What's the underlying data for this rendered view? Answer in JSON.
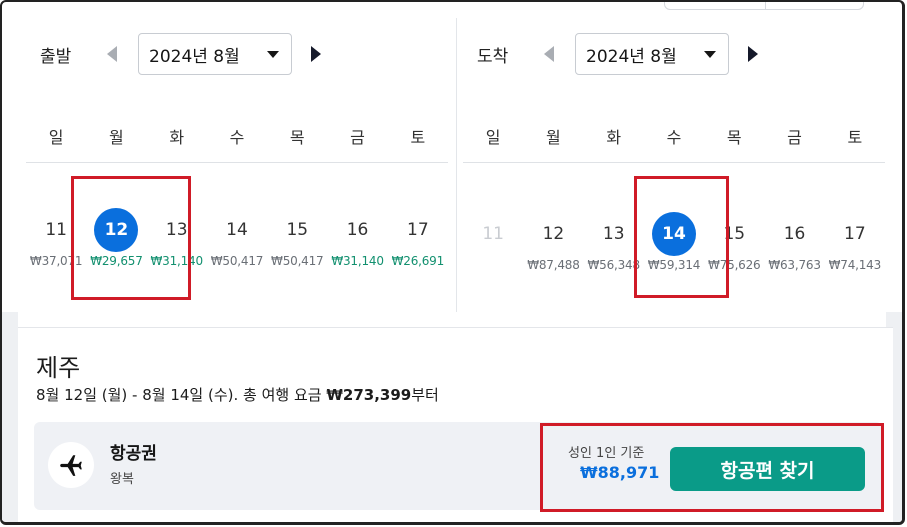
{
  "weekdays": [
    "일",
    "월",
    "화",
    "수",
    "목",
    "금",
    "토"
  ],
  "departure": {
    "title": "출발",
    "month": "2024년 8월",
    "days": [
      {
        "num": "11",
        "price": "₩37,071",
        "price_color": "gray"
      },
      {
        "num": "12",
        "price": "₩29,657",
        "price_color": "green",
        "selected": true
      },
      {
        "num": "13",
        "price": "₩31,140",
        "price_color": "green"
      },
      {
        "num": "14",
        "price": "₩50,417",
        "price_color": "gray"
      },
      {
        "num": "15",
        "price": "₩50,417",
        "price_color": "gray"
      },
      {
        "num": "16",
        "price": "₩31,140",
        "price_color": "green"
      },
      {
        "num": "17",
        "price": "₩26,691",
        "price_color": "green"
      }
    ]
  },
  "arrival": {
    "title": "도착",
    "month": "2024년 8월",
    "days": [
      {
        "num": "11",
        "price": "",
        "muted": true
      },
      {
        "num": "12",
        "price": "₩87,488",
        "price_color": "gray"
      },
      {
        "num": "13",
        "price": "₩56,348",
        "price_color": "gray"
      },
      {
        "num": "14",
        "price": "₩59,314",
        "price_color": "gray",
        "selected": true
      },
      {
        "num": "15",
        "price": "₩75,626",
        "price_color": "gray"
      },
      {
        "num": "16",
        "price": "₩63,763",
        "price_color": "gray"
      },
      {
        "num": "17",
        "price": "₩74,143",
        "price_color": "gray"
      }
    ]
  },
  "trip": {
    "destination": "제주",
    "summary_prefix": "8월 12일 (월) - 8월 14일 (수). 총 여행 요금 ",
    "total_price": "₩273,399",
    "summary_suffix": "부터"
  },
  "flight_card": {
    "title": "항공권",
    "subtitle": "왕복",
    "price_caption": "성인 1인 기준",
    "price": "₩88,971",
    "cta_label": "항공편 찾기"
  },
  "colors": {
    "selected": "#0a6fdd",
    "cheap_price": "#12906f",
    "cta": "#0a9b88",
    "highlight_box": "#d01b27"
  }
}
